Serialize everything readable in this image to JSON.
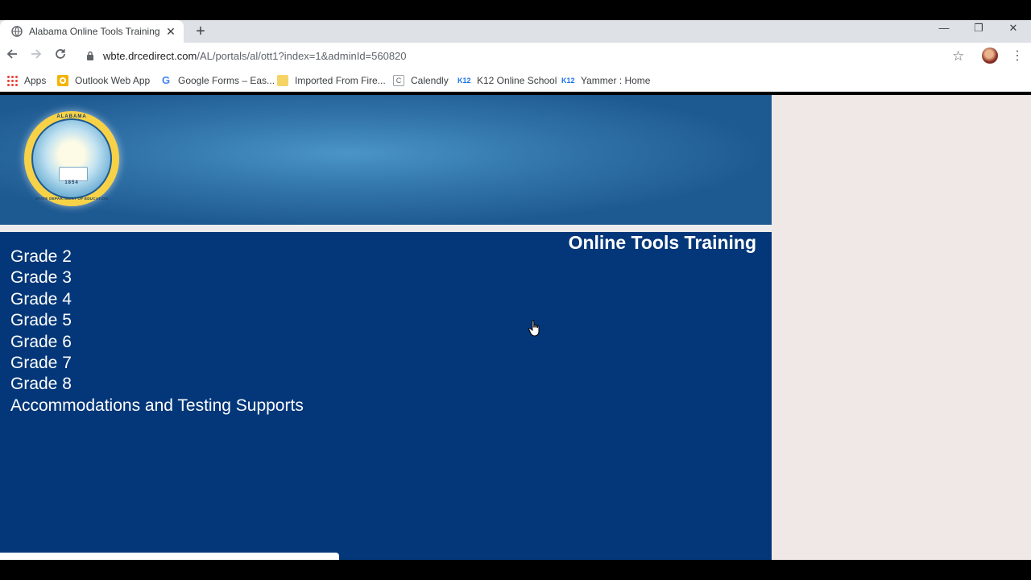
{
  "browser": {
    "tab_title": "Alabama Online Tools Training",
    "url_host": "wbte.drcedirect.com",
    "url_path": "/AL/portals/al/ott1?index=1&adminId=560820",
    "bookmarks": [
      {
        "label": "Apps",
        "icon": "apps-grid-icon"
      },
      {
        "label": "Outlook Web App",
        "icon": "outlook-icon"
      },
      {
        "label": "Google Forms – Eas...",
        "icon": "google-icon"
      },
      {
        "label": "Imported From Fire...",
        "icon": "folder-icon"
      },
      {
        "label": "Calendly",
        "icon": "calendly-icon"
      },
      {
        "label": "K12 Online School",
        "icon": "k12-icon"
      },
      {
        "label": "Yammer : Home",
        "icon": "k12-icon"
      }
    ]
  },
  "banner": {
    "seal_top_text": "ALABAMA",
    "seal_year": "1854",
    "seal_bottom_text": "STATE DEPARTMENT OF EDUCATION"
  },
  "page": {
    "title": "Online Tools Training",
    "links": [
      "Grade 2",
      "Grade 3",
      "Grade 4",
      "Grade 5",
      "Grade 6",
      "Grade 7",
      "Grade 8",
      "Accommodations and Testing Supports"
    ]
  },
  "colors": {
    "content_bg": "#033779",
    "banner_bg": "#3478ad",
    "side_bg": "#f0e8e6"
  }
}
